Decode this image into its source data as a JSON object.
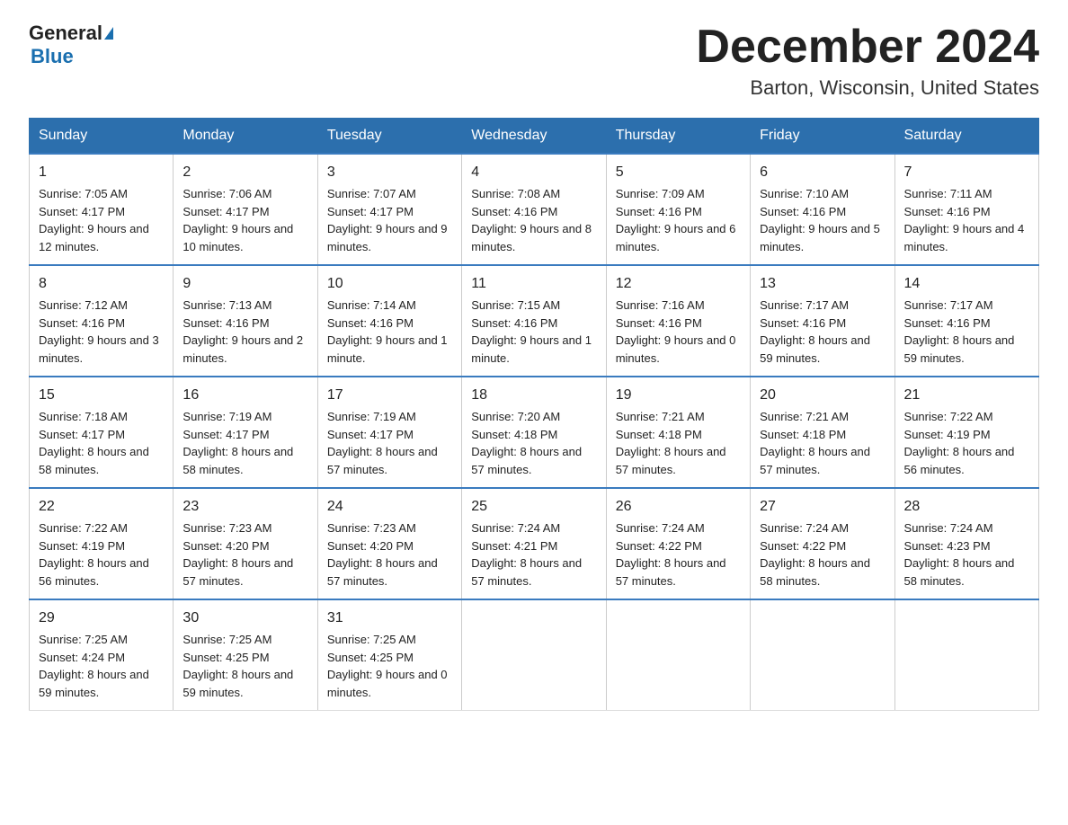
{
  "header": {
    "logo_general": "General",
    "logo_blue": "Blue",
    "month": "December 2024",
    "location": "Barton, Wisconsin, United States"
  },
  "days_of_week": [
    "Sunday",
    "Monday",
    "Tuesday",
    "Wednesday",
    "Thursday",
    "Friday",
    "Saturday"
  ],
  "weeks": [
    [
      {
        "day": "1",
        "sunrise": "7:05 AM",
        "sunset": "4:17 PM",
        "daylight": "9 hours and 12 minutes."
      },
      {
        "day": "2",
        "sunrise": "7:06 AM",
        "sunset": "4:17 PM",
        "daylight": "9 hours and 10 minutes."
      },
      {
        "day": "3",
        "sunrise": "7:07 AM",
        "sunset": "4:17 PM",
        "daylight": "9 hours and 9 minutes."
      },
      {
        "day": "4",
        "sunrise": "7:08 AM",
        "sunset": "4:16 PM",
        "daylight": "9 hours and 8 minutes."
      },
      {
        "day": "5",
        "sunrise": "7:09 AM",
        "sunset": "4:16 PM",
        "daylight": "9 hours and 6 minutes."
      },
      {
        "day": "6",
        "sunrise": "7:10 AM",
        "sunset": "4:16 PM",
        "daylight": "9 hours and 5 minutes."
      },
      {
        "day": "7",
        "sunrise": "7:11 AM",
        "sunset": "4:16 PM",
        "daylight": "9 hours and 4 minutes."
      }
    ],
    [
      {
        "day": "8",
        "sunrise": "7:12 AM",
        "sunset": "4:16 PM",
        "daylight": "9 hours and 3 minutes."
      },
      {
        "day": "9",
        "sunrise": "7:13 AM",
        "sunset": "4:16 PM",
        "daylight": "9 hours and 2 minutes."
      },
      {
        "day": "10",
        "sunrise": "7:14 AM",
        "sunset": "4:16 PM",
        "daylight": "9 hours and 1 minute."
      },
      {
        "day": "11",
        "sunrise": "7:15 AM",
        "sunset": "4:16 PM",
        "daylight": "9 hours and 1 minute."
      },
      {
        "day": "12",
        "sunrise": "7:16 AM",
        "sunset": "4:16 PM",
        "daylight": "9 hours and 0 minutes."
      },
      {
        "day": "13",
        "sunrise": "7:17 AM",
        "sunset": "4:16 PM",
        "daylight": "8 hours and 59 minutes."
      },
      {
        "day": "14",
        "sunrise": "7:17 AM",
        "sunset": "4:16 PM",
        "daylight": "8 hours and 59 minutes."
      }
    ],
    [
      {
        "day": "15",
        "sunrise": "7:18 AM",
        "sunset": "4:17 PM",
        "daylight": "8 hours and 58 minutes."
      },
      {
        "day": "16",
        "sunrise": "7:19 AM",
        "sunset": "4:17 PM",
        "daylight": "8 hours and 58 minutes."
      },
      {
        "day": "17",
        "sunrise": "7:19 AM",
        "sunset": "4:17 PM",
        "daylight": "8 hours and 57 minutes."
      },
      {
        "day": "18",
        "sunrise": "7:20 AM",
        "sunset": "4:18 PM",
        "daylight": "8 hours and 57 minutes."
      },
      {
        "day": "19",
        "sunrise": "7:21 AM",
        "sunset": "4:18 PM",
        "daylight": "8 hours and 57 minutes."
      },
      {
        "day": "20",
        "sunrise": "7:21 AM",
        "sunset": "4:18 PM",
        "daylight": "8 hours and 57 minutes."
      },
      {
        "day": "21",
        "sunrise": "7:22 AM",
        "sunset": "4:19 PM",
        "daylight": "8 hours and 56 minutes."
      }
    ],
    [
      {
        "day": "22",
        "sunrise": "7:22 AM",
        "sunset": "4:19 PM",
        "daylight": "8 hours and 56 minutes."
      },
      {
        "day": "23",
        "sunrise": "7:23 AM",
        "sunset": "4:20 PM",
        "daylight": "8 hours and 57 minutes."
      },
      {
        "day": "24",
        "sunrise": "7:23 AM",
        "sunset": "4:20 PM",
        "daylight": "8 hours and 57 minutes."
      },
      {
        "day": "25",
        "sunrise": "7:24 AM",
        "sunset": "4:21 PM",
        "daylight": "8 hours and 57 minutes."
      },
      {
        "day": "26",
        "sunrise": "7:24 AM",
        "sunset": "4:22 PM",
        "daylight": "8 hours and 57 minutes."
      },
      {
        "day": "27",
        "sunrise": "7:24 AM",
        "sunset": "4:22 PM",
        "daylight": "8 hours and 58 minutes."
      },
      {
        "day": "28",
        "sunrise": "7:24 AM",
        "sunset": "4:23 PM",
        "daylight": "8 hours and 58 minutes."
      }
    ],
    [
      {
        "day": "29",
        "sunrise": "7:25 AM",
        "sunset": "4:24 PM",
        "daylight": "8 hours and 59 minutes."
      },
      {
        "day": "30",
        "sunrise": "7:25 AM",
        "sunset": "4:25 PM",
        "daylight": "8 hours and 59 minutes."
      },
      {
        "day": "31",
        "sunrise": "7:25 AM",
        "sunset": "4:25 PM",
        "daylight": "9 hours and 0 minutes."
      },
      null,
      null,
      null,
      null
    ]
  ]
}
